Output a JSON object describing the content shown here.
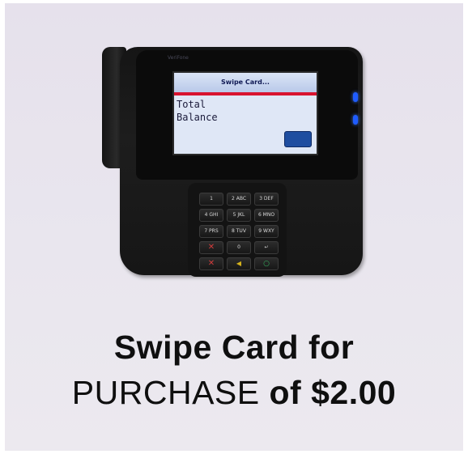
{
  "terminal": {
    "brand": "VeriFone",
    "screen": {
      "title": "Swipe Card...",
      "line1": "Total",
      "line2": "Balance"
    },
    "keys": [
      {
        "label": "1",
        "name": "key-1"
      },
      {
        "label": "2 ABC",
        "name": "key-2"
      },
      {
        "label": "3 DEF",
        "name": "key-3"
      },
      {
        "label": "4 GHI",
        "name": "key-4"
      },
      {
        "label": "5 JKL",
        "name": "key-5"
      },
      {
        "label": "6 MNO",
        "name": "key-6"
      },
      {
        "label": "7 PRS",
        "name": "key-7"
      },
      {
        "label": "8 TUV",
        "name": "key-8"
      },
      {
        "label": "9 WXY",
        "name": "key-9"
      },
      {
        "label": "✕",
        "name": "key-cancel"
      },
      {
        "label": "0",
        "name": "key-0"
      },
      {
        "label": "↵",
        "name": "key-enter"
      },
      {
        "label": "✕",
        "name": "key-cancel-red"
      },
      {
        "label": "◀",
        "name": "key-clear"
      },
      {
        "label": "○",
        "name": "key-ok"
      }
    ],
    "led_color": "#1f5cff"
  },
  "caption": {
    "line1": "Swipe Card for",
    "line2_prefix": "PURCHASE",
    "line2_suffix": " of $2.00"
  }
}
